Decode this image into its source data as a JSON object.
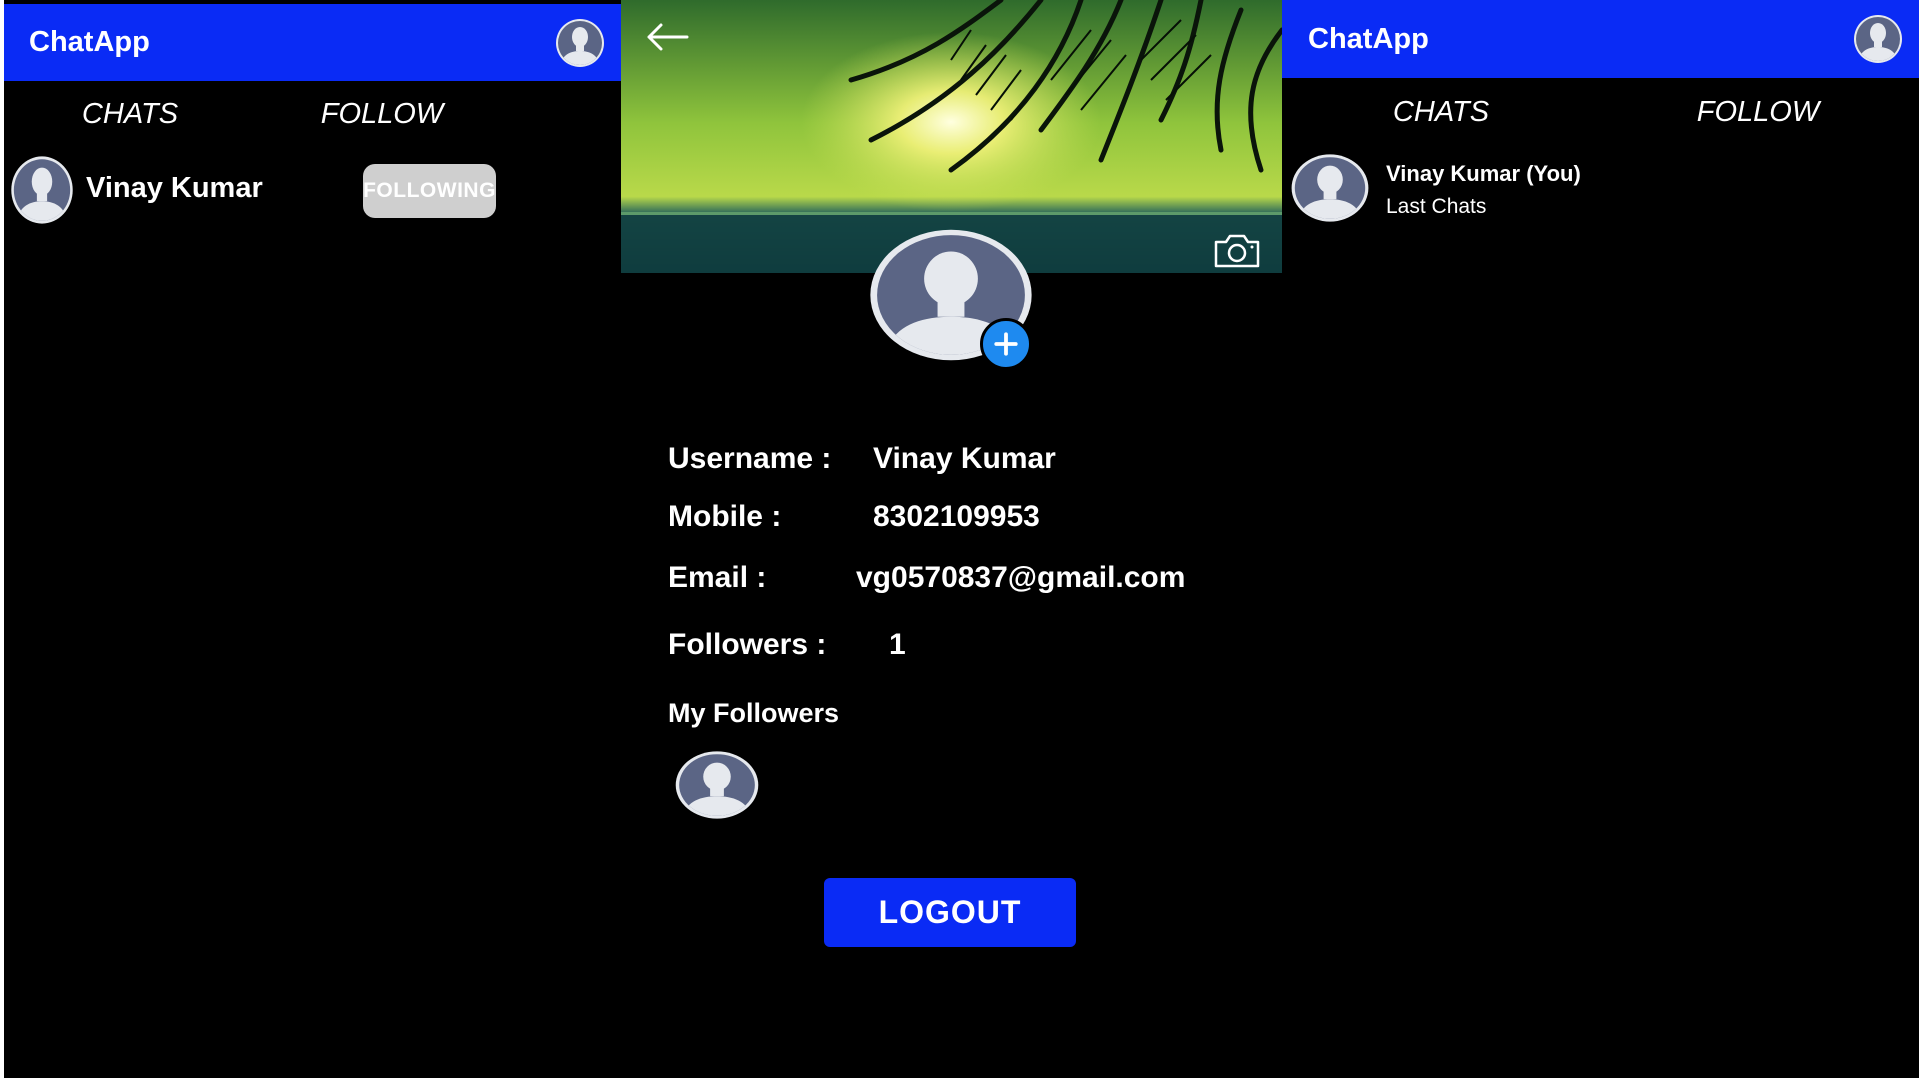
{
  "app": {
    "title": "ChatApp"
  },
  "left_screen": {
    "tabs": [
      {
        "label": "CHATS"
      },
      {
        "label": "FOLLOW"
      }
    ],
    "follow_list": [
      {
        "name": "Vinay Kumar",
        "button_label": "FOLLOWING"
      }
    ]
  },
  "profile_screen": {
    "fields": {
      "username": {
        "label": "Username :",
        "value": "Vinay Kumar"
      },
      "mobile": {
        "label": "Mobile :",
        "value": "8302109953"
      },
      "email": {
        "label": "Email :",
        "value": "vg0570837@gmail.com"
      },
      "followers": {
        "label": "Followers :",
        "value": "1"
      }
    },
    "followers_heading": "My Followers",
    "logout_label": "LOGOUT"
  },
  "right_screen": {
    "tabs": [
      {
        "label": "CHATS"
      },
      {
        "label": "FOLLOW"
      }
    ],
    "chat_list": [
      {
        "name": "Vinay Kumar (You)",
        "subtitle": "Last Chats"
      }
    ]
  },
  "icons": {
    "avatar": "person-avatar-icon",
    "back": "arrow-left-icon",
    "camera": "camera-icon",
    "add": "plus-icon"
  },
  "colors": {
    "app_bar": "#0a2bf5",
    "background": "#000000",
    "following_button": "#cfcfcf",
    "add_photo": "#1e8af0",
    "avatar_bg": "#5b6585",
    "avatar_fg": "#e6e9ee"
  }
}
